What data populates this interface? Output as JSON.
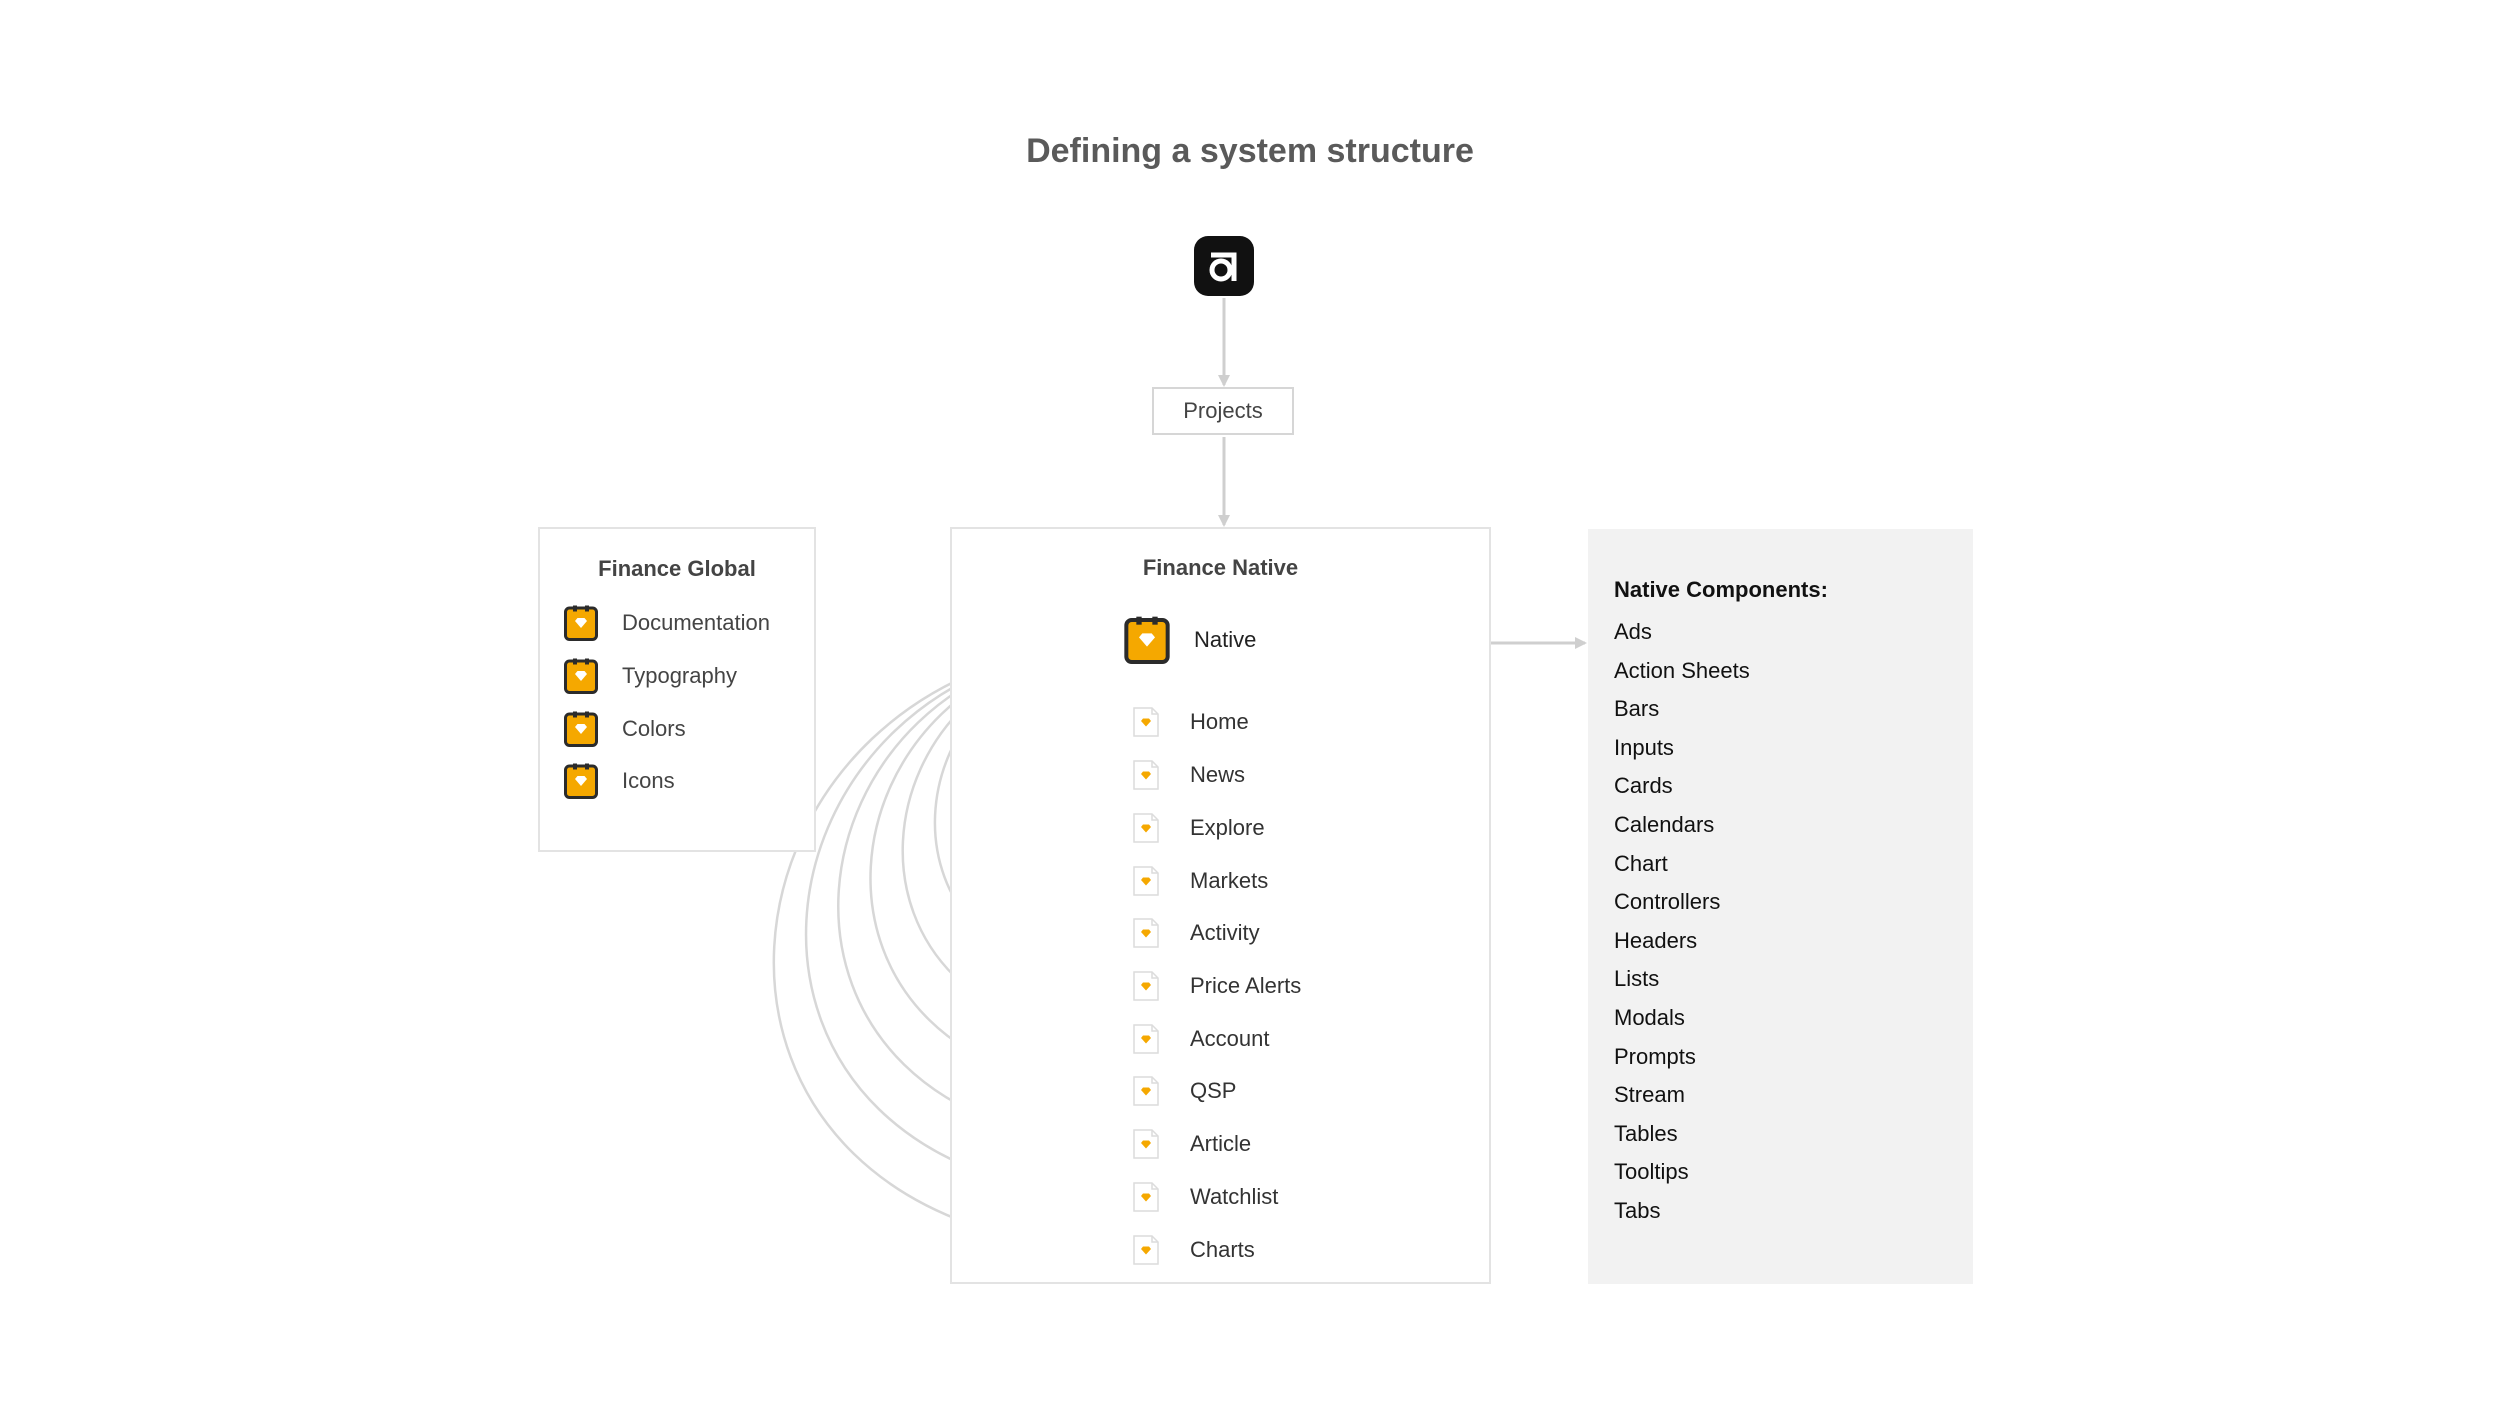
{
  "title": "Defining a system structure",
  "root": {
    "icon": "abstract-logo-icon"
  },
  "projects_label": "Projects",
  "finance_global": {
    "title": "Finance Global",
    "items": [
      "Documentation",
      "Typography",
      "Colors",
      "Icons"
    ],
    "item_icon": "sketch-library-icon"
  },
  "finance_native": {
    "title": "Finance Native",
    "library": {
      "label": "Native",
      "icon": "sketch-library-icon"
    },
    "pages": [
      "Home",
      "News",
      "Explore",
      "Markets",
      "Activity",
      "Price Alerts",
      "Account",
      "QSP",
      "Article",
      "Watchlist",
      "Charts"
    ],
    "page_icon": "sketch-file-icon"
  },
  "components": {
    "title": "Native Components:",
    "items": [
      "Ads",
      "Action Sheets",
      "Bars",
      "Inputs",
      "Cards",
      "Calendars",
      "Chart",
      "Controllers",
      "Headers",
      "Lists",
      "Modals",
      "Prompts",
      "Stream",
      "Tables",
      "Tooltips",
      "Tabs"
    ]
  },
  "colors": {
    "accent": "#f5a800",
    "icon_frame": "#2b2b2b",
    "connector": "#cfcfcf",
    "components_bg": "#f2f2f2"
  }
}
